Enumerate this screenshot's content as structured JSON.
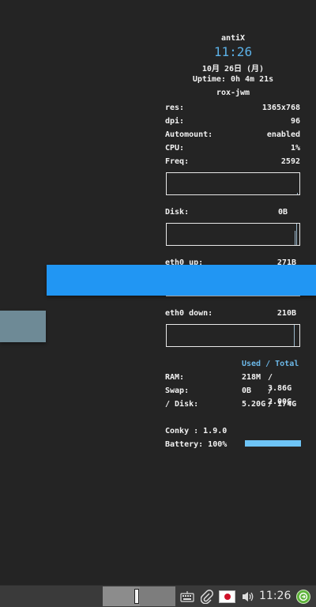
{
  "conky": {
    "hostname": "antiX",
    "time": "11:26",
    "date": "10月 26日 (月)",
    "uptime": "Uptime: 0h 4m 21s",
    "wm": "rox-jwm",
    "stats": [
      {
        "key": "res:",
        "value": "1365x768"
      },
      {
        "key": "dpi:",
        "value": "96"
      },
      {
        "key": "Automount:",
        "value": "enabled"
      },
      {
        "key": "CPU:",
        "value": "1%"
      },
      {
        "key": "Freq:",
        "value": "2592"
      }
    ],
    "disk": {
      "label": "Disk:",
      "value": "0B"
    },
    "eth_up": {
      "label": "eth0 up:",
      "value": "271B"
    },
    "eth_down": {
      "label": "eth0 down:",
      "value": "210B"
    },
    "usage_header": "Used / Total",
    "usage": [
      {
        "label": "RAM:",
        "used": "218M",
        "total": "/ 3.86G"
      },
      {
        "label": "Swap:",
        "used": "0B",
        "total": "/ 2.00G"
      },
      {
        "label": "/ Disk:",
        "used": "5.20G",
        "total": "/ 174G"
      }
    ],
    "conky_version": "Conky : 1.9.0",
    "battery_label": "Battery: 100%",
    "battery_percent": 100
  },
  "taskbar": {
    "clock": "11:26",
    "icons": [
      "keyboard-icon",
      "paperclip-icon",
      "japan-flag-icon",
      "volume-icon",
      "power-icon"
    ]
  },
  "colors": {
    "accent": "#2196f3",
    "conky_blue": "#5bb0e6",
    "battery_bar": "#6ec4f6"
  }
}
